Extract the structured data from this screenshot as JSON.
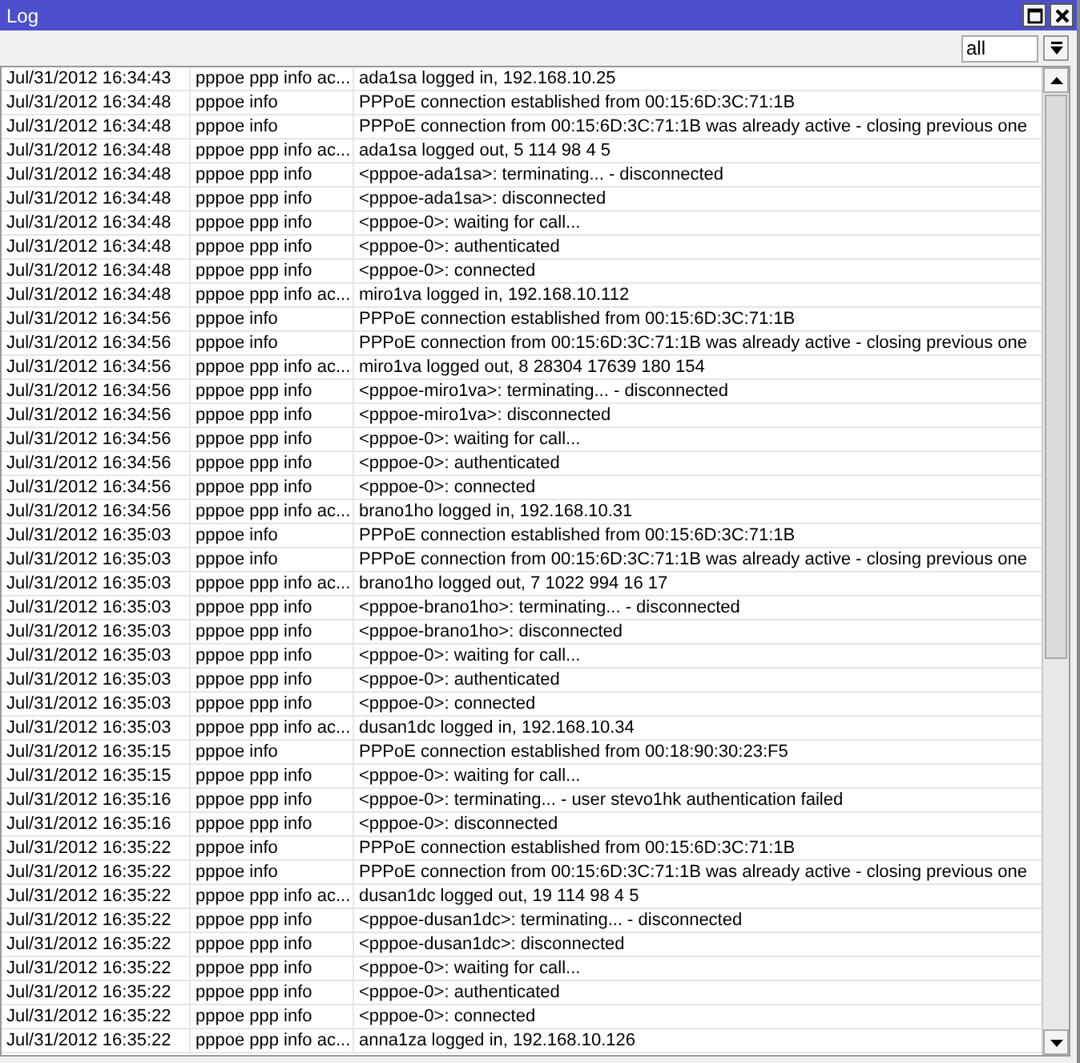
{
  "window": {
    "title": "Log"
  },
  "filter": {
    "value": "all"
  },
  "rows": [
    {
      "time": "Jul/31/2012 16:34:43",
      "topics": "pppoe ppp info ac...",
      "message": "ada1sa logged in, 192.168.10.25"
    },
    {
      "time": "Jul/31/2012 16:34:48",
      "topics": "pppoe info",
      "message": "PPPoE connection established from 00:15:6D:3C:71:1B"
    },
    {
      "time": "Jul/31/2012 16:34:48",
      "topics": "pppoe info",
      "message": "PPPoE connection from 00:15:6D:3C:71:1B was already active - closing previous one"
    },
    {
      "time": "Jul/31/2012 16:34:48",
      "topics": "pppoe ppp info ac...",
      "message": "ada1sa logged out, 5 114 98 4 5"
    },
    {
      "time": "Jul/31/2012 16:34:48",
      "topics": "pppoe ppp info",
      "message": "<pppoe-ada1sa>: terminating... - disconnected"
    },
    {
      "time": "Jul/31/2012 16:34:48",
      "topics": "pppoe ppp info",
      "message": "<pppoe-ada1sa>: disconnected"
    },
    {
      "time": "Jul/31/2012 16:34:48",
      "topics": "pppoe ppp info",
      "message": "<pppoe-0>: waiting for call..."
    },
    {
      "time": "Jul/31/2012 16:34:48",
      "topics": "pppoe ppp info",
      "message": "<pppoe-0>: authenticated"
    },
    {
      "time": "Jul/31/2012 16:34:48",
      "topics": "pppoe ppp info",
      "message": "<pppoe-0>: connected"
    },
    {
      "time": "Jul/31/2012 16:34:48",
      "topics": "pppoe ppp info ac...",
      "message": "miro1va logged in, 192.168.10.112"
    },
    {
      "time": "Jul/31/2012 16:34:56",
      "topics": "pppoe info",
      "message": "PPPoE connection established from 00:15:6D:3C:71:1B"
    },
    {
      "time": "Jul/31/2012 16:34:56",
      "topics": "pppoe info",
      "message": "PPPoE connection from 00:15:6D:3C:71:1B was already active - closing previous one"
    },
    {
      "time": "Jul/31/2012 16:34:56",
      "topics": "pppoe ppp info ac...",
      "message": "miro1va logged out, 8 28304 17639 180 154"
    },
    {
      "time": "Jul/31/2012 16:34:56",
      "topics": "pppoe ppp info",
      "message": "<pppoe-miro1va>: terminating... - disconnected"
    },
    {
      "time": "Jul/31/2012 16:34:56",
      "topics": "pppoe ppp info",
      "message": "<pppoe-miro1va>: disconnected"
    },
    {
      "time": "Jul/31/2012 16:34:56",
      "topics": "pppoe ppp info",
      "message": "<pppoe-0>: waiting for call..."
    },
    {
      "time": "Jul/31/2012 16:34:56",
      "topics": "pppoe ppp info",
      "message": "<pppoe-0>: authenticated"
    },
    {
      "time": "Jul/31/2012 16:34:56",
      "topics": "pppoe ppp info",
      "message": "<pppoe-0>: connected"
    },
    {
      "time": "Jul/31/2012 16:34:56",
      "topics": "pppoe ppp info ac...",
      "message": "brano1ho logged in, 192.168.10.31"
    },
    {
      "time": "Jul/31/2012 16:35:03",
      "topics": "pppoe info",
      "message": "PPPoE connection established from 00:15:6D:3C:71:1B"
    },
    {
      "time": "Jul/31/2012 16:35:03",
      "topics": "pppoe info",
      "message": "PPPoE connection from 00:15:6D:3C:71:1B was already active - closing previous one"
    },
    {
      "time": "Jul/31/2012 16:35:03",
      "topics": "pppoe ppp info ac...",
      "message": "brano1ho logged out, 7 1022 994 16 17"
    },
    {
      "time": "Jul/31/2012 16:35:03",
      "topics": "pppoe ppp info",
      "message": "<pppoe-brano1ho>: terminating... - disconnected"
    },
    {
      "time": "Jul/31/2012 16:35:03",
      "topics": "pppoe ppp info",
      "message": "<pppoe-brano1ho>: disconnected"
    },
    {
      "time": "Jul/31/2012 16:35:03",
      "topics": "pppoe ppp info",
      "message": "<pppoe-0>: waiting for call..."
    },
    {
      "time": "Jul/31/2012 16:35:03",
      "topics": "pppoe ppp info",
      "message": "<pppoe-0>: authenticated"
    },
    {
      "time": "Jul/31/2012 16:35:03",
      "topics": "pppoe ppp info",
      "message": "<pppoe-0>: connected"
    },
    {
      "time": "Jul/31/2012 16:35:03",
      "topics": "pppoe ppp info ac...",
      "message": "dusan1dc logged in, 192.168.10.34"
    },
    {
      "time": "Jul/31/2012 16:35:15",
      "topics": "pppoe info",
      "message": "PPPoE connection established from 00:18:90:30:23:F5"
    },
    {
      "time": "Jul/31/2012 16:35:15",
      "topics": "pppoe ppp info",
      "message": "<pppoe-0>: waiting for call..."
    },
    {
      "time": "Jul/31/2012 16:35:16",
      "topics": "pppoe ppp info",
      "message": "<pppoe-0>: terminating... - user stevo1hk authentication failed"
    },
    {
      "time": "Jul/31/2012 16:35:16",
      "topics": "pppoe ppp info",
      "message": "<pppoe-0>: disconnected"
    },
    {
      "time": "Jul/31/2012 16:35:22",
      "topics": "pppoe info",
      "message": "PPPoE connection established from 00:15:6D:3C:71:1B"
    },
    {
      "time": "Jul/31/2012 16:35:22",
      "topics": "pppoe info",
      "message": "PPPoE connection from 00:15:6D:3C:71:1B was already active - closing previous one"
    },
    {
      "time": "Jul/31/2012 16:35:22",
      "topics": "pppoe ppp info ac...",
      "message": "dusan1dc logged out, 19 114 98 4 5"
    },
    {
      "time": "Jul/31/2012 16:35:22",
      "topics": "pppoe ppp info",
      "message": "<pppoe-dusan1dc>: terminating... - disconnected"
    },
    {
      "time": "Jul/31/2012 16:35:22",
      "topics": "pppoe ppp info",
      "message": "<pppoe-dusan1dc>: disconnected"
    },
    {
      "time": "Jul/31/2012 16:35:22",
      "topics": "pppoe ppp info",
      "message": "<pppoe-0>: waiting for call..."
    },
    {
      "time": "Jul/31/2012 16:35:22",
      "topics": "pppoe ppp info",
      "message": "<pppoe-0>: authenticated"
    },
    {
      "time": "Jul/31/2012 16:35:22",
      "topics": "pppoe ppp info",
      "message": "<pppoe-0>: connected"
    },
    {
      "time": "Jul/31/2012 16:35:22",
      "topics": "pppoe ppp info ac...",
      "message": "anna1za logged in, 192.168.10.126"
    }
  ]
}
